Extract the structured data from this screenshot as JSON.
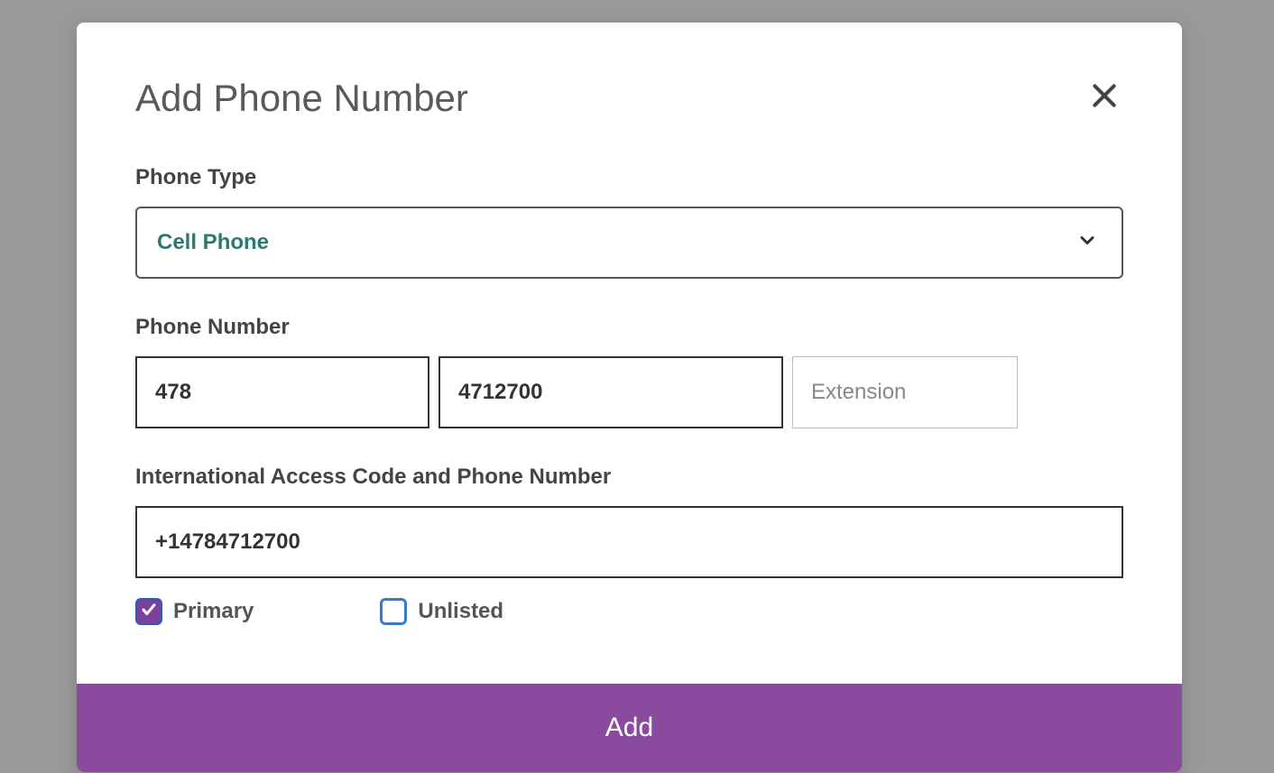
{
  "modal": {
    "title": "Add Phone Number",
    "phoneType": {
      "label": "Phone Type",
      "value": "Cell Phone"
    },
    "phoneNumber": {
      "label": "Phone Number",
      "areaCode": "478",
      "mainNumber": "4712700",
      "extensionPlaceholder": "Extension",
      "extensionValue": ""
    },
    "international": {
      "label": "International Access Code and Phone Number",
      "value": "+14784712700"
    },
    "checkboxes": {
      "primary": {
        "label": "Primary",
        "checked": true
      },
      "unlisted": {
        "label": "Unlisted",
        "checked": false
      }
    },
    "addButton": "Add"
  }
}
